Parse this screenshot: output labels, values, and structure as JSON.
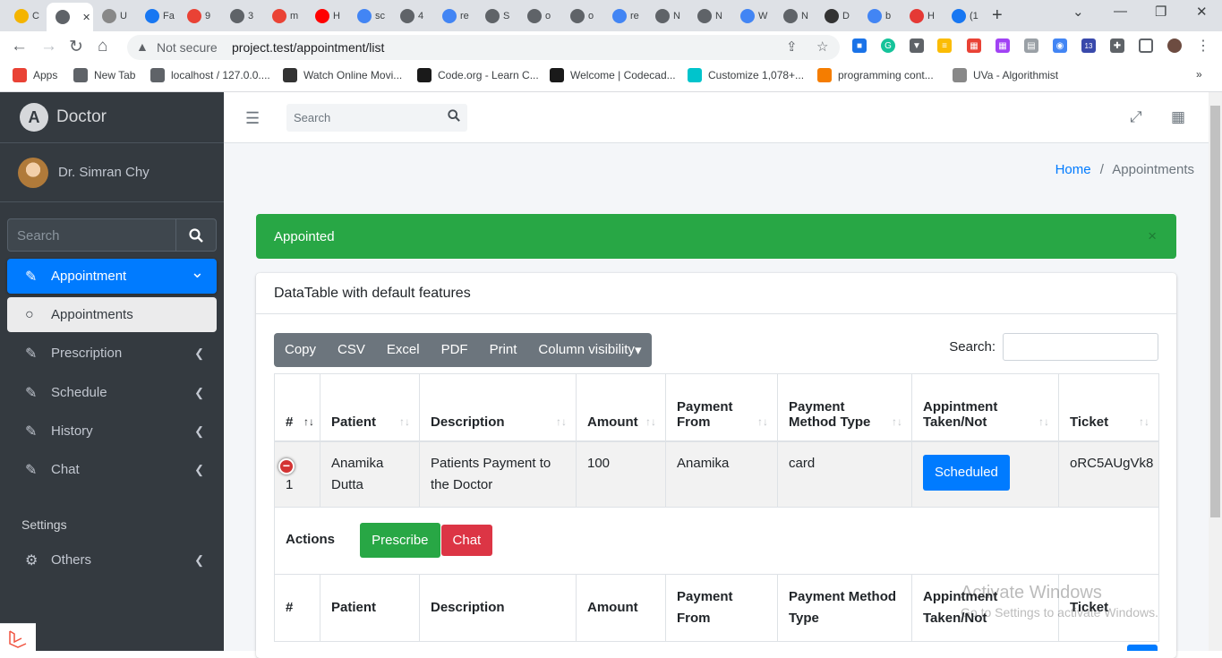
{
  "browser": {
    "tabs": [
      {
        "icon": "analytics-icon",
        "label": "C",
        "color": "#f4b400"
      },
      {
        "icon": "globe-icon",
        "label": "",
        "color": "#5f6368",
        "active": true
      },
      {
        "icon": "uva-icon",
        "label": "U",
        "color": "#888888"
      },
      {
        "icon": "facebook-icon",
        "label": "Fa",
        "color": "#1877f2"
      },
      {
        "icon": "plus-icon",
        "label": "9",
        "color": "#e94235"
      },
      {
        "icon": "globe-icon",
        "label": "3",
        "color": "#5f6368"
      },
      {
        "icon": "gmail-icon",
        "label": "m",
        "color": "#ea4335"
      },
      {
        "icon": "youtube-icon",
        "label": "H",
        "color": "#ff0000"
      },
      {
        "icon": "google-icon",
        "label": "sc",
        "color": "#4285f4"
      },
      {
        "icon": "globe-icon",
        "label": "4",
        "color": "#5f6368"
      },
      {
        "icon": "google-icon",
        "label": "re",
        "color": "#4285f4"
      },
      {
        "icon": "globe-icon",
        "label": "S",
        "color": "#5f6368"
      },
      {
        "icon": "globe-icon",
        "label": "o",
        "color": "#5f6368"
      },
      {
        "icon": "globe-icon",
        "label": "o",
        "color": "#5f6368"
      },
      {
        "icon": "google-icon",
        "label": "re",
        "color": "#4285f4"
      },
      {
        "icon": "globe-icon",
        "label": "N",
        "color": "#5f6368"
      },
      {
        "icon": "globe-icon",
        "label": "N",
        "color": "#5f6368"
      },
      {
        "icon": "google-icon",
        "label": "W",
        "color": "#4285f4"
      },
      {
        "icon": "globe-icon",
        "label": "N",
        "color": "#5f6368"
      },
      {
        "icon": "wikipedia-icon",
        "label": "D",
        "color": "#333333"
      },
      {
        "icon": "google-icon",
        "label": "b",
        "color": "#4285f4"
      },
      {
        "icon": "globe-icon",
        "label": "H",
        "color": "#e53935"
      },
      {
        "icon": "facebook-icon",
        "label": "(1",
        "color": "#1877f2"
      }
    ],
    "new_tab": "+",
    "not_secure": "Not secure",
    "url": "project.test/appointment/list",
    "extension_badge": "13",
    "bookmarks": [
      {
        "icon": "apps-grid-icon",
        "label": "Apps",
        "color": "#e94235"
      },
      {
        "icon": "globe-icon",
        "label": "New Tab",
        "color": "#5f6368"
      },
      {
        "icon": "globe-icon",
        "label": "localhost / 127.0.0....",
        "color": "#5f6368"
      },
      {
        "icon": "film-icon",
        "label": "Watch Online Movi...",
        "color": "#333333"
      },
      {
        "icon": "code-org-icon",
        "label": "Code.org - Learn C...",
        "color": "#1a1a1a"
      },
      {
        "icon": "codecademy-icon",
        "label": "Welcome | Codecad...",
        "color": "#1a1a1a"
      },
      {
        "icon": "canva-icon",
        "label": "Customize 1,078+...",
        "color": "#00c4cc"
      },
      {
        "icon": "blogger-icon",
        "label": "programming cont...",
        "color": "#f57d00"
      },
      {
        "icon": "uva-icon",
        "label": "UVa - Algorithmist",
        "color": "#888888"
      }
    ]
  },
  "sidebar": {
    "brand": "Doctor",
    "user": "Dr. Simran Chy",
    "search_placeholder": "Search",
    "menu": [
      {
        "label": "Appointment",
        "icon": "edit-icon",
        "active": true
      },
      {
        "label": "Appointments",
        "icon": "circle-icon",
        "sub": true
      },
      {
        "label": "Prescription",
        "icon": "edit-icon"
      },
      {
        "label": "Schedule",
        "icon": "edit-icon"
      },
      {
        "label": "History",
        "icon": "edit-icon"
      },
      {
        "label": "Chat",
        "icon": "edit-icon"
      }
    ],
    "settings_header": "Settings",
    "others": {
      "label": "Others",
      "icon": "cogs-icon"
    }
  },
  "topbar": {
    "search_placeholder": "Search"
  },
  "breadcrumb": {
    "home": "Home",
    "separator": "/",
    "current": "Appointments"
  },
  "alert": {
    "text": "Appointed",
    "close": "×"
  },
  "card": {
    "title": "DataTable with default features"
  },
  "toolbar": {
    "buttons": [
      "Copy",
      "CSV",
      "Excel",
      "PDF",
      "Print",
      "Column visibility"
    ]
  },
  "dt_search_label": "Search:",
  "table": {
    "headers": [
      "#",
      "Patient",
      "Description",
      "Amount",
      "Payment From",
      "Payment Method Type",
      "Appintment Taken/Not",
      "Ticket"
    ],
    "header_lines": [
      [
        "#"
      ],
      [
        "Patient"
      ],
      [
        "Description"
      ],
      [
        "Amount"
      ],
      [
        "Payment",
        "From"
      ],
      [
        "Payment",
        "Method Type"
      ],
      [
        "Appintment",
        "Taken/Not"
      ],
      [
        "Ticket"
      ]
    ],
    "rows": [
      {
        "num": "1",
        "patient": "Anamika Dutta",
        "description": "Patients Payment to the Doctor",
        "amount": "100",
        "payment_from": "Anamika",
        "method": "card",
        "status": "Scheduled",
        "ticket": "oRC5AUgVk8"
      }
    ],
    "child": {
      "label": "Actions",
      "prescribe": "Prescribe",
      "chat": "Chat"
    },
    "footer_lines": [
      [
        "#"
      ],
      [
        "Patient"
      ],
      [
        "Description"
      ],
      [
        "Amount"
      ],
      [
        "Payment",
        "From"
      ],
      [
        "Payment Method",
        "Type"
      ],
      [
        "Appintment",
        "Taken/Not"
      ],
      [
        "Ticket"
      ]
    ]
  },
  "watermark": {
    "line1": "Activate Windows",
    "line2": "Go to Settings to activate Windows."
  }
}
